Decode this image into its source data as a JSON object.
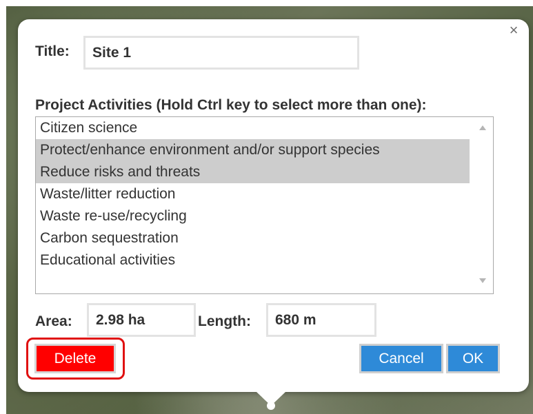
{
  "dialog": {
    "close_symbol": "×",
    "title_label": "Title:",
    "title_value": "Site 1",
    "activities_label": "Project Activities (Hold Ctrl key to select more than one):",
    "activities": [
      {
        "label": "Citizen science",
        "selected": false
      },
      {
        "label": "Protect/enhance environment and/or support species",
        "selected": true
      },
      {
        "label": "Reduce risks and threats",
        "selected": true
      },
      {
        "label": "Waste/litter reduction",
        "selected": false
      },
      {
        "label": "Waste re-use/recycling",
        "selected": false
      },
      {
        "label": "Carbon sequestration",
        "selected": false
      },
      {
        "label": "Educational activities",
        "selected": false
      }
    ],
    "area_label": "Area:",
    "area_value": "2.98 ha",
    "length_label": "Length:",
    "length_value": "680 m",
    "buttons": {
      "delete": "Delete",
      "cancel": "Cancel",
      "ok": "OK"
    }
  },
  "colors": {
    "delete": "#ff0000",
    "primary": "#2e8ad8",
    "highlight_outline": "#e01010",
    "selected_row": "#cdcdcd"
  }
}
